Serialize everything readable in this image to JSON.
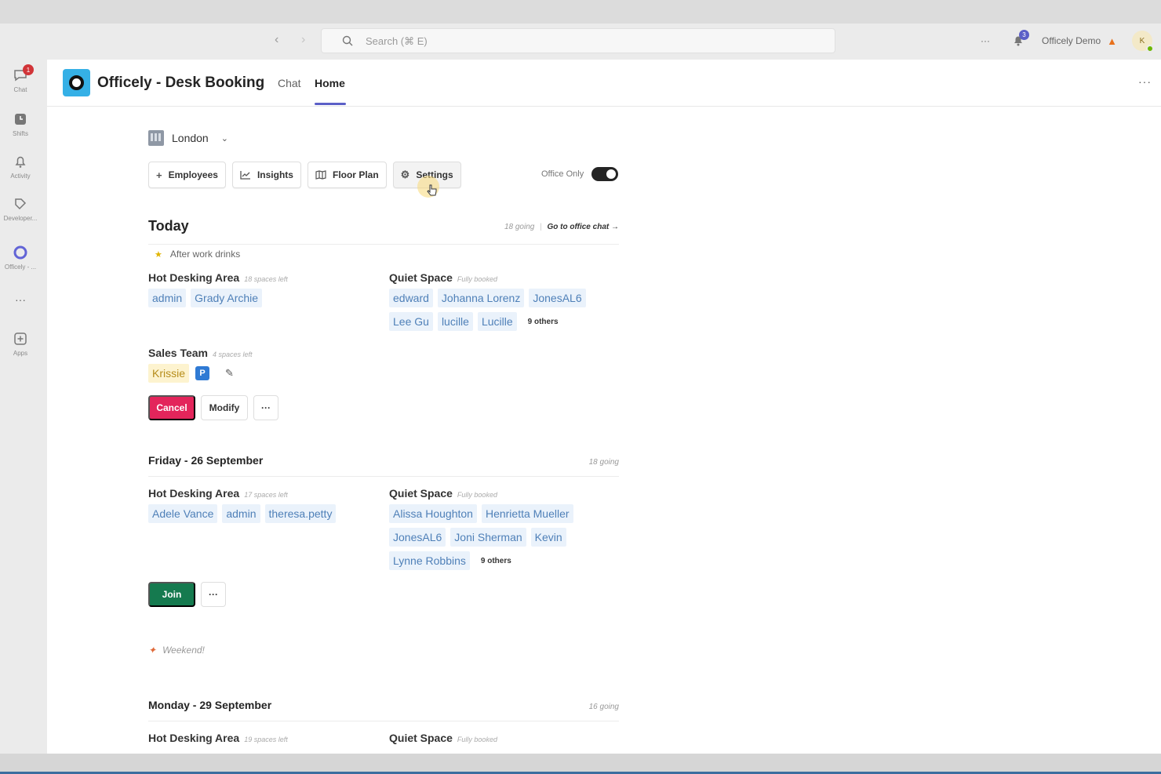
{
  "titlebar": {
    "search_placeholder": "Search (⌘ E)",
    "more_label": "···",
    "notification_count": "3",
    "org_name": "Officely Demo",
    "avatar_initial": "K"
  },
  "rail": {
    "items": [
      {
        "label": "Chat",
        "badge": "1"
      },
      {
        "label": "Shifts"
      },
      {
        "label": "Activity"
      },
      {
        "label": "Developer..."
      },
      {
        "label": "Officely - ..."
      },
      {
        "label": "···"
      },
      {
        "label": "Apps"
      }
    ]
  },
  "app": {
    "title": "Officely - Desk Booking",
    "tabs": [
      {
        "label": "Chat"
      },
      {
        "label": "Home"
      }
    ],
    "active_tab": "Home",
    "more_label": "···"
  },
  "location": {
    "name": "London"
  },
  "toolbar": {
    "employees": "Employees",
    "insights": "Insights",
    "floor_plan": "Floor Plan",
    "settings": "Settings",
    "office_only_label": "Office Only",
    "office_only_on": true
  },
  "today": {
    "title": "Today",
    "going": "18 going",
    "separator": "|",
    "office_chat_link": "Go to office chat →",
    "event": "After work drinks",
    "hot_desking": {
      "title": "Hot Desking Area",
      "sub": "18 spaces left",
      "people": [
        "admin",
        "Grady Archie"
      ]
    },
    "quiet_space": {
      "title": "Quiet Space",
      "sub": "Fully booked",
      "people": [
        "edward",
        "Johanna Lorenz",
        "JonesAL6",
        "Lee Gu",
        "lucille",
        "Lucille"
      ],
      "others": "9 others"
    },
    "sales_team": {
      "title": "Sales Team",
      "sub": "4 spaces left",
      "self": "Krissie",
      "parking_badge": "P"
    },
    "buttons": {
      "cancel": "Cancel",
      "modify": "Modify",
      "more": "···"
    }
  },
  "friday": {
    "title": "Friday - 26 September",
    "going": "18 going",
    "hot_desking": {
      "title": "Hot Desking Area",
      "sub": "17 spaces left",
      "people": [
        "Adele Vance",
        "admin",
        "theresa.petty"
      ]
    },
    "quiet_space": {
      "title": "Quiet Space",
      "sub": "Fully booked",
      "people": [
        "Alissa Houghton",
        "Henrietta Mueller",
        "JonesAL6",
        "Joni Sherman",
        "Kevin",
        "Lynne Robbins"
      ],
      "others": "9 others"
    },
    "buttons": {
      "join": "Join",
      "more": "···"
    }
  },
  "weekend": {
    "label": "Weekend!"
  },
  "monday": {
    "title": "Monday - 29 September",
    "going": "16 going",
    "hot_desking": {
      "title": "Hot Desking Area",
      "sub": "19 spaces left"
    },
    "quiet_space": {
      "title": "Quiet Space",
      "sub": "Fully booked"
    }
  },
  "colors": {
    "accent": "#5b5fc7",
    "cancel": "#e3255b",
    "join": "#157a4f",
    "chip_bg": "#eaf2fb",
    "chip_text": "#4f80b8",
    "logo": "#35b0e6"
  }
}
